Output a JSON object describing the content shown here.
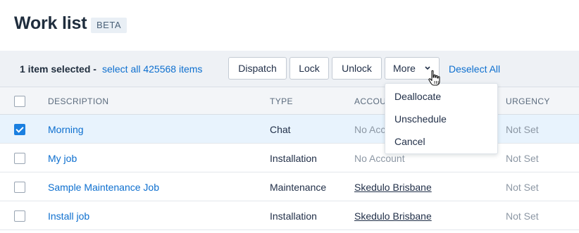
{
  "page": {
    "title": "Work list",
    "badge": "BETA"
  },
  "actionbar": {
    "selected_text": "1 item selected -",
    "select_all_link": "select all 425568 items",
    "buttons": {
      "dispatch": "Dispatch",
      "lock": "Lock",
      "unlock": "Unlock",
      "more": "More"
    },
    "deselect_all": "Deselect All"
  },
  "table": {
    "columns": [
      "DESCRIPTION",
      "TYPE",
      "ACCOU",
      "URGENCY"
    ],
    "rows": [
      {
        "selected": true,
        "description": "Morning",
        "type": "Chat",
        "account": "No Accou",
        "account_linked": false,
        "urgency": "Not Set"
      },
      {
        "selected": false,
        "description": "My job",
        "type": "Installation",
        "account": "No Account",
        "account_linked": false,
        "urgency": "Not Set"
      },
      {
        "selected": false,
        "description": "Sample Maintenance Job",
        "type": "Maintenance",
        "account": "Skedulo Brisbane",
        "account_linked": true,
        "urgency": "Not Set"
      },
      {
        "selected": false,
        "description": "Install job",
        "type": "Installation",
        "account": "Skedulo Brisbane",
        "account_linked": true,
        "urgency": "Not Set"
      }
    ]
  },
  "more_menu": {
    "items": [
      "Deallocate",
      "Unschedule",
      "Cancel"
    ]
  },
  "icons": {
    "chevron": "chevron-down-icon",
    "check": "checkmark-icon",
    "cursor": "hand-pointer-cursor-icon"
  },
  "colors": {
    "accent": "#0d6fcf",
    "selected_row": "#e8f3fd",
    "checkbox_checked": "#1a7fe0"
  }
}
